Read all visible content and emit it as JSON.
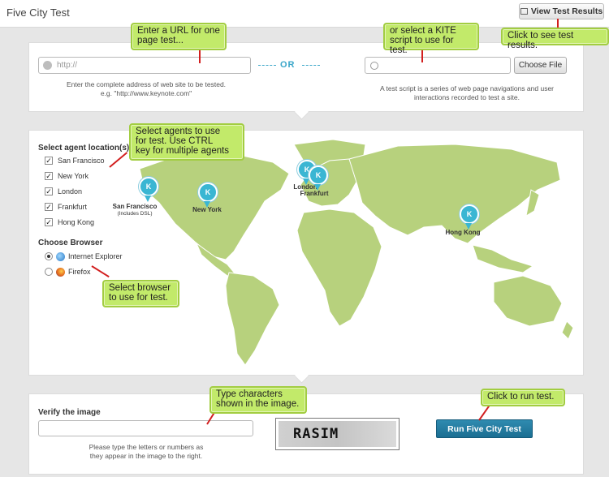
{
  "app": {
    "title": "Five City Test"
  },
  "header": {
    "view_results_label": "View Test Results"
  },
  "url_section": {
    "url_placeholder": "http://",
    "or_label": "OR",
    "url_help_line1": "Enter the complete address of web site to be tested.",
    "url_help_line2": "e.g. \"http://www.keynote.com\"",
    "choose_file_label": "Choose File",
    "script_help_line1": "A test script is a series of web page navigations and user",
    "script_help_line2": "interactions recorded to test a site."
  },
  "agents": {
    "heading": "Select agent location(s)",
    "items": [
      {
        "label": "San Francisco",
        "checked": true
      },
      {
        "label": "New York",
        "checked": true
      },
      {
        "label": "London",
        "checked": true
      },
      {
        "label": "Frankfurt",
        "checked": true
      },
      {
        "label": "Hong Kong",
        "checked": true
      }
    ]
  },
  "browser": {
    "heading": "Choose Browser",
    "options": [
      {
        "label": "Internet Explorer",
        "selected": true,
        "icon": "ie-icon"
      },
      {
        "label": "Firefox",
        "selected": false,
        "icon": "firefox-icon"
      }
    ]
  },
  "map": {
    "pins": [
      {
        "city": "San Francisco",
        "sub": "(Includes DSL)"
      },
      {
        "city": "New York"
      },
      {
        "city": "London"
      },
      {
        "city": "Frankfurt"
      },
      {
        "city": "Hong Kong"
      }
    ],
    "land_color": "#b7d17d",
    "pin_color": "#3ab6d3"
  },
  "verify": {
    "heading": "Verify the image",
    "help_line1": "Please type the letters or numbers as",
    "help_line2": "they appear in the image to the right.",
    "captcha_text": "RASIM"
  },
  "run_button_label": "Run Five City Test",
  "callouts": {
    "url": [
      "Enter a URL for one",
      "page test..."
    ],
    "script": [
      "or select a KITE",
      "script to use for test."
    ],
    "results": [
      "Click to see test results."
    ],
    "agents": [
      "Select agents to use",
      "for test. Use CTRL",
      "key for multiple agents"
    ],
    "browser": [
      "Select browser",
      "to use for test."
    ],
    "captcha": [
      "Type characters",
      "shown in the image."
    ],
    "run": [
      "Click to run test."
    ]
  },
  "colors": {
    "accent": "#3aa6c9",
    "callout": "#c2ea6a",
    "callout_line": "#d21f1f",
    "run_button": "#1f7aa0"
  }
}
